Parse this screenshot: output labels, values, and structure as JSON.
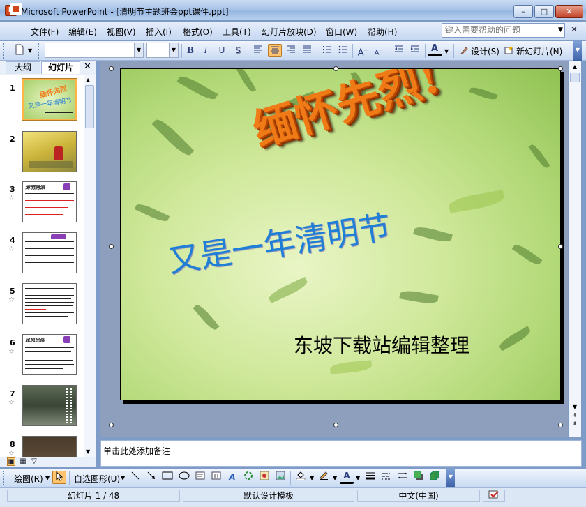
{
  "window": {
    "title": "Microsoft PowerPoint - [清明节主题班会ppt课件.ppt]",
    "app_icon": "powerpoint-icon",
    "minimize": "–",
    "maximize": "□",
    "close": "✕"
  },
  "menubar": {
    "items": [
      "文件(F)",
      "编辑(E)",
      "视图(V)",
      "插入(I)",
      "格式(O)",
      "工具(T)",
      "幻灯片放映(D)",
      "窗口(W)",
      "帮助(H)"
    ],
    "help_placeholder": "键入需要帮助的问题",
    "doc_close": "✕"
  },
  "format_toolbar": {
    "font_name": "",
    "font_size": "",
    "bold": "B",
    "italic": "I",
    "underline": "U",
    "shadow": "S",
    "font_color_glyph": "A",
    "design_label": "设计(S)",
    "new_slide_label": "新幻灯片(N)"
  },
  "left_pane": {
    "tab_outline": "大纲",
    "tab_slides": "幻灯片",
    "close": "✕",
    "thumbnails": [
      {
        "number": "1",
        "starred": false,
        "selected": true
      },
      {
        "number": "2",
        "starred": false,
        "selected": false
      },
      {
        "number": "3",
        "starred": true,
        "selected": false
      },
      {
        "number": "4",
        "starred": true,
        "selected": false
      },
      {
        "number": "5",
        "starred": true,
        "selected": false
      },
      {
        "number": "6",
        "starred": true,
        "selected": false
      },
      {
        "number": "7",
        "starred": true,
        "selected": false
      },
      {
        "number": "8",
        "starred": true,
        "selected": false
      }
    ]
  },
  "slide": {
    "title": "缅怀先烈!",
    "subtitle": "又是一年清明节",
    "credit": "东坡下载站编辑整理"
  },
  "notes": {
    "placeholder": "单击此处添加备注"
  },
  "drawing_toolbar": {
    "draw_label": "绘图(R)",
    "autoshapes_label": "自选图形(U)"
  },
  "status": {
    "slide_position": "幻灯片 1 / 48",
    "template": "默认设计模板",
    "language": "中文(中国)"
  },
  "colors": {
    "title_orange": "#f07b16",
    "subtitle_blue": "#1f7fd6",
    "toolbar_blue": "#c8daf2",
    "selection_orange": "#ffb347"
  }
}
